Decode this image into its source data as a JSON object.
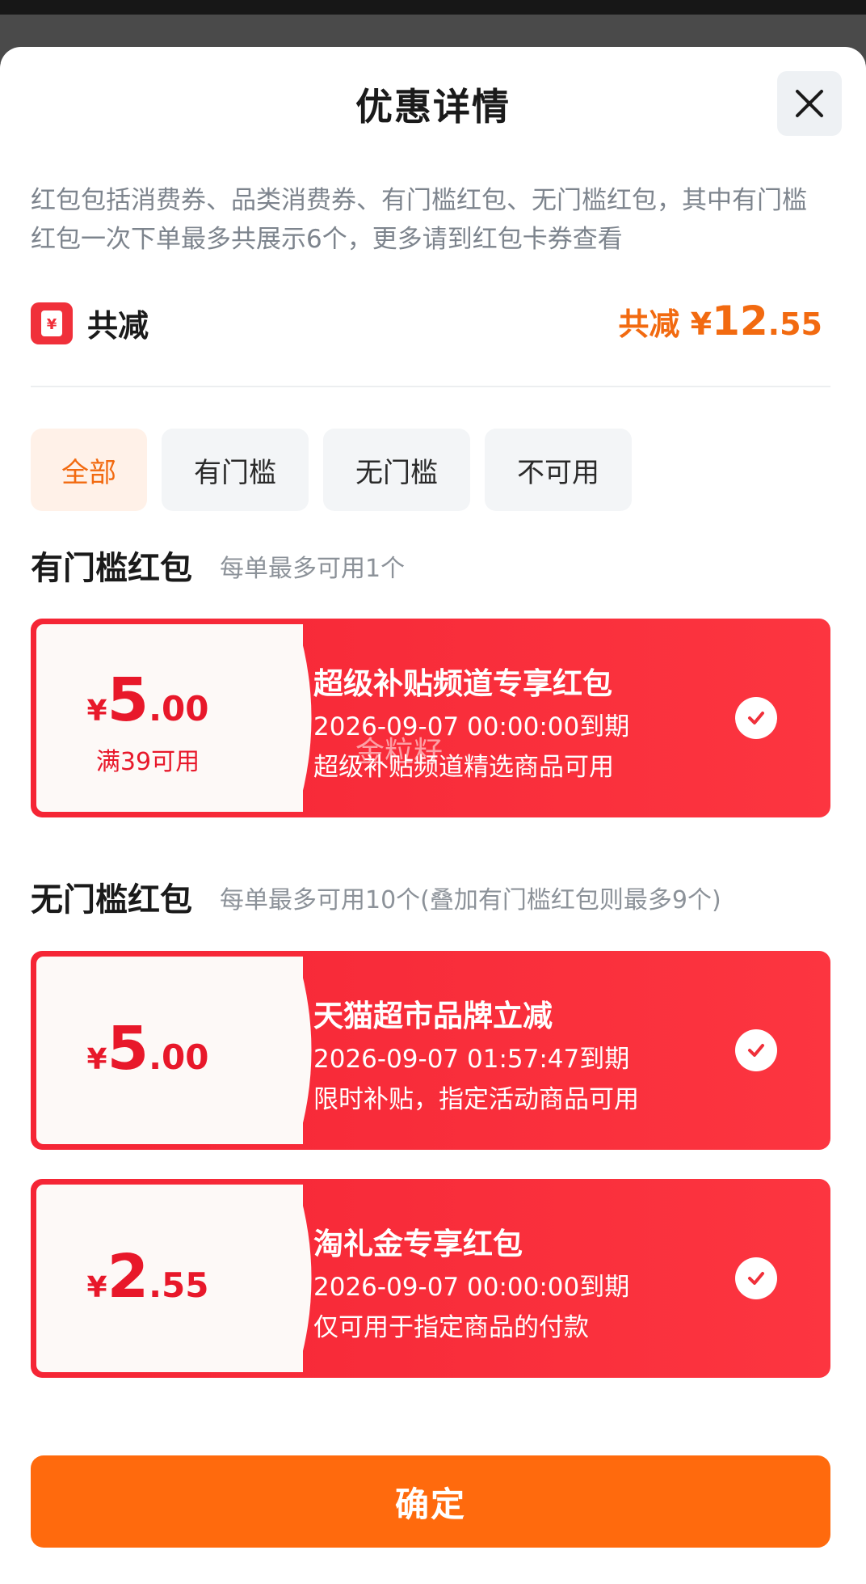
{
  "header": {
    "title": "优惠详情"
  },
  "description": "红包包括消费券、品类消费券、有门槛红包、无门槛红包，其中有门槛红包一次下单最多共展示6个，更多请到红包卡券查看",
  "total": {
    "label": "共减",
    "prefix": "共减 ¥",
    "value_int": "12",
    "value_dec": ".55"
  },
  "tabs": [
    {
      "label": "全部",
      "active": true
    },
    {
      "label": "有门槛",
      "active": false
    },
    {
      "label": "无门槛",
      "active": false
    },
    {
      "label": "不可用",
      "active": false
    }
  ],
  "sections": [
    {
      "title": "有门槛红包",
      "note": "每单最多可用1个",
      "coupons": [
        {
          "currency": "¥",
          "amount_int": "5",
          "amount_dec": ".00",
          "condition": "满39可用",
          "name": "超级补贴频道专享红包",
          "expiry": "2026-09-07 00:00:00到期",
          "rule": "超级补贴频道精选商品可用",
          "selected": true
        }
      ]
    },
    {
      "title": "无门槛红包",
      "note": "每单最多可用10个(叠加有门槛红包则最多9个)",
      "coupons": [
        {
          "currency": "¥",
          "amount_int": "5",
          "amount_dec": ".00",
          "name": "天猫超市品牌立减",
          "expiry": "2026-09-07 01:57:47到期",
          "rule": "限时补贴，指定活动商品可用",
          "selected": true
        },
        {
          "currency": "¥",
          "amount_int": "2",
          "amount_dec": ".55",
          "name": "淘礼金专享红包",
          "expiry": "2026-09-07 00:00:00到期",
          "rule": "仅可用于指定商品的付款",
          "selected": true
        }
      ]
    }
  ],
  "watermark": "金粒籽",
  "confirm_label": "确定",
  "colors": {
    "accent": "#f26a10",
    "coupon_red": "#f52535",
    "confirm": "#ff6a0d"
  },
  "icons": {
    "close": "close-icon",
    "wallet": "red-packet-icon",
    "check": "check-icon"
  }
}
